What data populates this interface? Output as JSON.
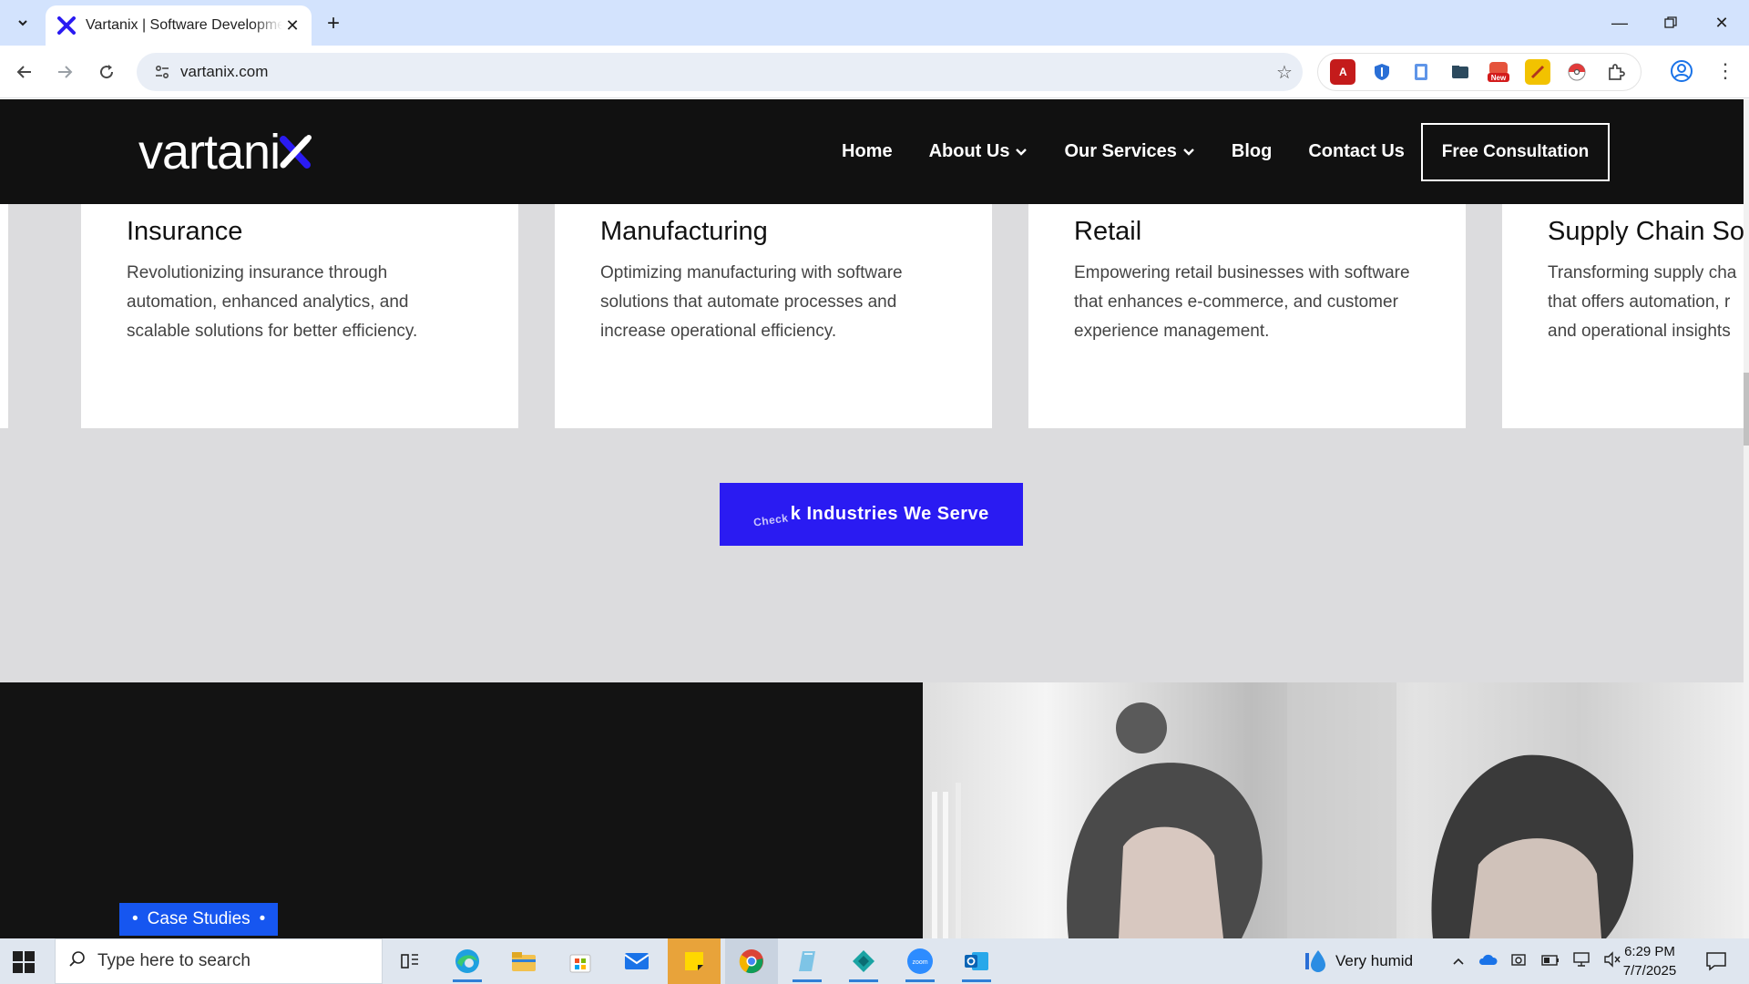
{
  "browser": {
    "tab_title": "Vartanix | Software Development",
    "url": "vartanix.com",
    "new_badge": "New"
  },
  "site": {
    "nav": {
      "home": "Home",
      "about": "About Us",
      "services": "Our Services",
      "blog": "Blog",
      "contact": "Contact Us",
      "cta": "Free Consultation"
    },
    "logo_text": "vartani",
    "cards": [
      {
        "title": "Insurance",
        "text": "Revolutionizing insurance through automation, enhanced analytics, and scalable solutions for better efficiency."
      },
      {
        "title": "Manufacturing",
        "text": "Optimizing manufacturing with software solutions that automate processes and increase operational efficiency."
      },
      {
        "title": "Retail",
        "text": "Empowering retail businesses with software that enhances e-commerce, and customer experience management."
      },
      {
        "title": "Supply Chain Sol",
        "text": "Transforming supply cha that offers automation, r and operational insights"
      }
    ],
    "industries_button_ghost": "Check",
    "industries_button": "k Industries We Serve",
    "case_badge": "Case Studies"
  },
  "taskbar": {
    "search_placeholder": "Type here to search",
    "weather": "Very humid",
    "time": "6:29 PM",
    "date": "7/7/2025"
  },
  "colors": {
    "accent_blue": "#2a1bf2",
    "badge_blue": "#1656f0",
    "header_bg": "#111111",
    "chrome_bg": "#d3e3fd"
  }
}
